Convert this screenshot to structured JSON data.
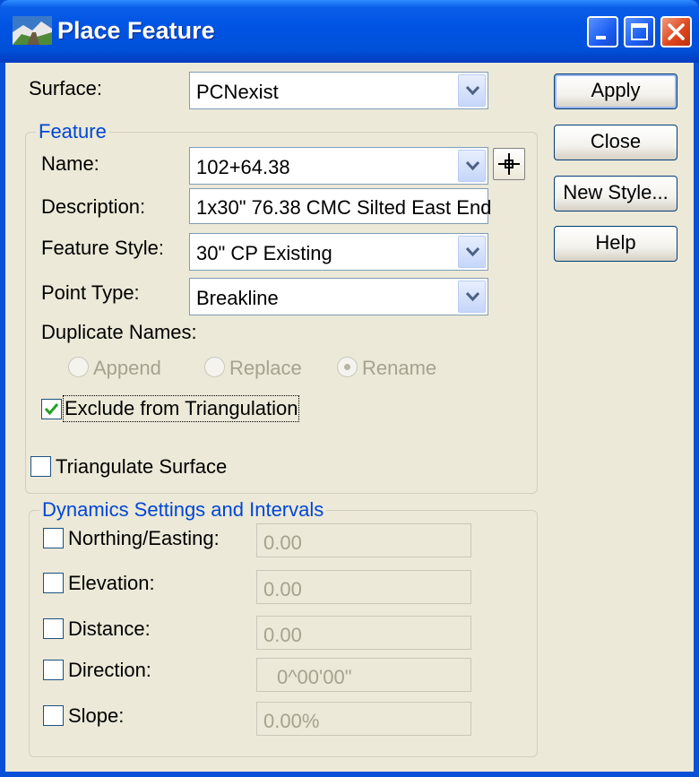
{
  "window": {
    "title": "Place Feature"
  },
  "surface": {
    "label": "Surface:",
    "value": "PCNexist"
  },
  "feature": {
    "group_title": "Feature",
    "name": {
      "label": "Name:",
      "value": "102+64.38"
    },
    "description": {
      "label": "Description:",
      "value": "1x30\" 76.38 CMC Silted East End"
    },
    "feature_style": {
      "label": "Feature Style:",
      "value": "30\" CP Existing"
    },
    "point_type": {
      "label": "Point Type:",
      "value": "Breakline"
    },
    "duplicate_names": {
      "label": "Duplicate Names:",
      "options": [
        "Append",
        "Replace",
        "Rename"
      ],
      "selected": "Rename"
    },
    "exclude": {
      "label": "Exclude from Triangulation",
      "checked": true
    }
  },
  "triangulate": {
    "label": "Triangulate Surface",
    "checked": false
  },
  "dynamics": {
    "group_title": "Dynamics Settings and Intervals",
    "rows": [
      {
        "label": "Northing/Easting:",
        "value": "0.00",
        "checked": false
      },
      {
        "label": "Elevation:",
        "value": "0.00",
        "checked": false
      },
      {
        "label": "Distance:",
        "value": "0.00",
        "checked": false
      },
      {
        "label": "Direction:",
        "value": "0^00'00\"",
        "checked": false
      },
      {
        "label": "Slope:",
        "value": "0.00%",
        "checked": false
      }
    ]
  },
  "buttons": {
    "apply": "Apply",
    "close": "Close",
    "new_style": "New Style...",
    "help": "Help"
  },
  "icons": {
    "app": "place-feature-app-icon",
    "minimize": "minimize-icon",
    "maximize": "maximize-icon",
    "close": "close-icon",
    "dropdown": "chevron-down-icon",
    "pick": "crosshair-icon",
    "check": "checkmark-icon"
  },
  "colors": {
    "titlebar": "#0054e3",
    "client": "#ece9d8",
    "group_title": "#0046d5",
    "close_button": "#e0481e"
  }
}
